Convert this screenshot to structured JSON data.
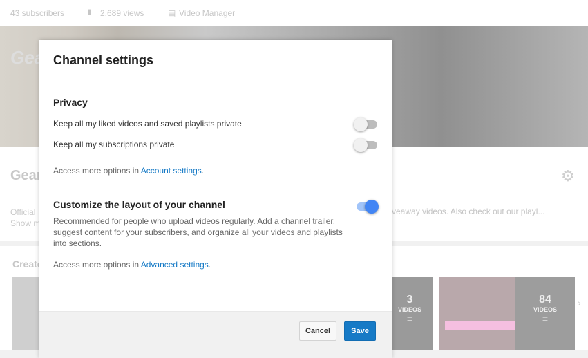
{
  "background": {
    "stats": {
      "subscribers": "43 subscribers",
      "views": "2,689 views",
      "video_manager": "Video Manager"
    },
    "banner_logo": "Gear",
    "channel_name_fragment": "Gear",
    "description_fragment": [
      "Official",
      "Show m"
    ],
    "description_right_fragment": "veaway videos. Also check out our playl...",
    "section_title_fragment": "Create",
    "playlists": [
      {
        "count": "3",
        "label": "VIDEOS"
      },
      {
        "count": "84",
        "label": "VIDEOS"
      }
    ]
  },
  "dialog": {
    "title": "Channel settings",
    "privacy": {
      "heading": "Privacy",
      "options": [
        {
          "label": "Keep all my liked videos and saved playlists private",
          "enabled": false
        },
        {
          "label": "Keep all my subscriptions private",
          "enabled": false
        }
      ],
      "more_prefix": "Access more options in ",
      "more_link": "Account settings",
      "more_suffix": "."
    },
    "layout": {
      "heading": "Customize the layout of your channel",
      "enabled": true,
      "description": "Recommended for people who upload videos regularly. Add a channel trailer, suggest content for your subscribers, and organize all your videos and playlists into sections.",
      "more_prefix": "Access more options in ",
      "more_link": "Advanced settings",
      "more_suffix": "."
    },
    "cancel_label": "Cancel",
    "save_label": "Save"
  },
  "colors": {
    "accent": "#167ac6",
    "toggle_on": "#4285f4"
  }
}
